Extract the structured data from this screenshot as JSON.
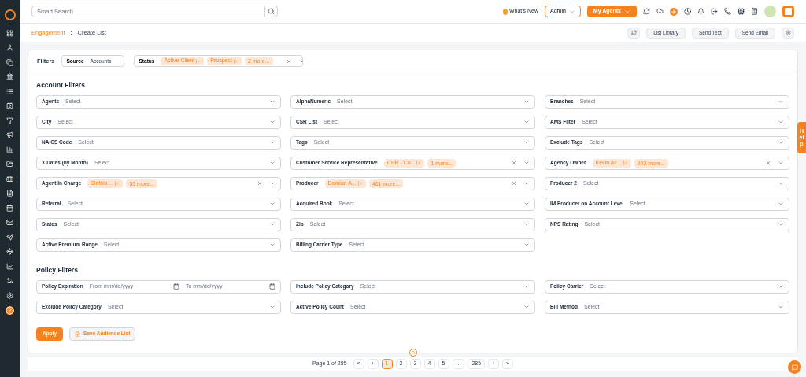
{
  "topbar": {
    "search": {
      "placeholder": "Smart Search"
    },
    "whats_new": "What's New",
    "role": "Admin",
    "agents_button": "My Agents"
  },
  "breadcrumb": [
    {
      "label": "Engagement",
      "link": true
    },
    {
      "label": "Create List",
      "link": false
    }
  ],
  "actions": [
    "List Library",
    "Send Text",
    "Send Email"
  ],
  "filters_bar": {
    "title": "Filters",
    "source": {
      "label": "Source",
      "value": "Accounts"
    },
    "status": {
      "label": "Status",
      "tags": [
        "Active Client",
        "Prospect"
      ],
      "more": "2 more..."
    }
  },
  "account_filters": {
    "title": "Account Filters",
    "fields": [
      {
        "label": "Agents",
        "placeholder": "Select"
      },
      {
        "label": "AlphaNumeric",
        "placeholder": "Select"
      },
      {
        "label": "Branches",
        "placeholder": "Select"
      },
      {
        "label": "City",
        "placeholder": "Select"
      },
      {
        "label": "CSR List",
        "placeholder": "Select"
      },
      {
        "label": "AMS Filter",
        "placeholder": "Select"
      },
      {
        "label": "NAICS Code",
        "placeholder": "Select"
      },
      {
        "label": "Tags",
        "placeholder": "Select"
      },
      {
        "label": "Exclude Tags",
        "placeholder": "Select"
      },
      {
        "label": "X Dates (by Month)",
        "placeholder": "Select"
      },
      {
        "label": "Customer Service Representative",
        "tags": [
          "CSR - Co..."
        ],
        "more": "1 more..."
      },
      {
        "label": "Agency Owner",
        "tags": [
          "Kevin Ac..."
        ],
        "more": "202 more..."
      },
      {
        "label": "Agent In Charge",
        "tags": [
          "Sinthia ..."
        ],
        "more": "53 more..."
      },
      {
        "label": "Producer",
        "tags": [
          "Demian A..."
        ],
        "more": "461 more..."
      },
      {
        "label": "Producer 2",
        "placeholder": "Select"
      },
      {
        "label": "Referral",
        "placeholder": "Select"
      },
      {
        "label": "Acquired Book",
        "placeholder": "Select"
      },
      {
        "label": "IM Producer on Account Level",
        "placeholder": "Select"
      },
      {
        "label": "States",
        "placeholder": "Select"
      },
      {
        "label": "Zip",
        "placeholder": "Select"
      },
      {
        "label": "NPS Rating",
        "placeholder": "Select"
      },
      {
        "label": "Active Premium Range",
        "placeholder": "Select"
      },
      {
        "label": "Billing Carrier Type",
        "placeholder": "Select"
      }
    ]
  },
  "policy_filters": {
    "title": "Policy Filters",
    "fields": [
      {
        "kind": "date_range",
        "label": "Policy Expiration",
        "from": {
          "placeholder": "From mm/dd/yyyy"
        },
        "to": {
          "placeholder": "To mm/dd/yyyy"
        }
      },
      {
        "kind": "select",
        "label": "Include Policy Category",
        "placeholder": "Select"
      },
      {
        "kind": "select",
        "label": "Policy Carrier",
        "placeholder": "Select"
      },
      {
        "kind": "select",
        "label": "Exclude Policy Category",
        "placeholder": "Select"
      },
      {
        "kind": "select",
        "label": "Active Policy Count",
        "placeholder": "Select"
      },
      {
        "kind": "select",
        "label": "Bill Method",
        "placeholder": "Select"
      }
    ]
  },
  "buttons": {
    "apply": "Apply",
    "save": "Save Audience List"
  },
  "pagination": {
    "summary": "Page 1 of 285",
    "pages": [
      {
        "label": "«",
        "selected": false
      },
      {
        "label": "‹",
        "selected": false
      },
      {
        "label": "1",
        "selected": true
      },
      {
        "label": "2",
        "selected": false
      },
      {
        "label": "3",
        "selected": false
      },
      {
        "label": "4",
        "selected": false
      },
      {
        "label": "5",
        "selected": false
      },
      {
        "label": "...",
        "selected": false
      },
      {
        "label": "285",
        "selected": false
      },
      {
        "label": "›",
        "selected": false
      },
      {
        "label": "»",
        "selected": false
      }
    ]
  },
  "help_tab": "Help"
}
